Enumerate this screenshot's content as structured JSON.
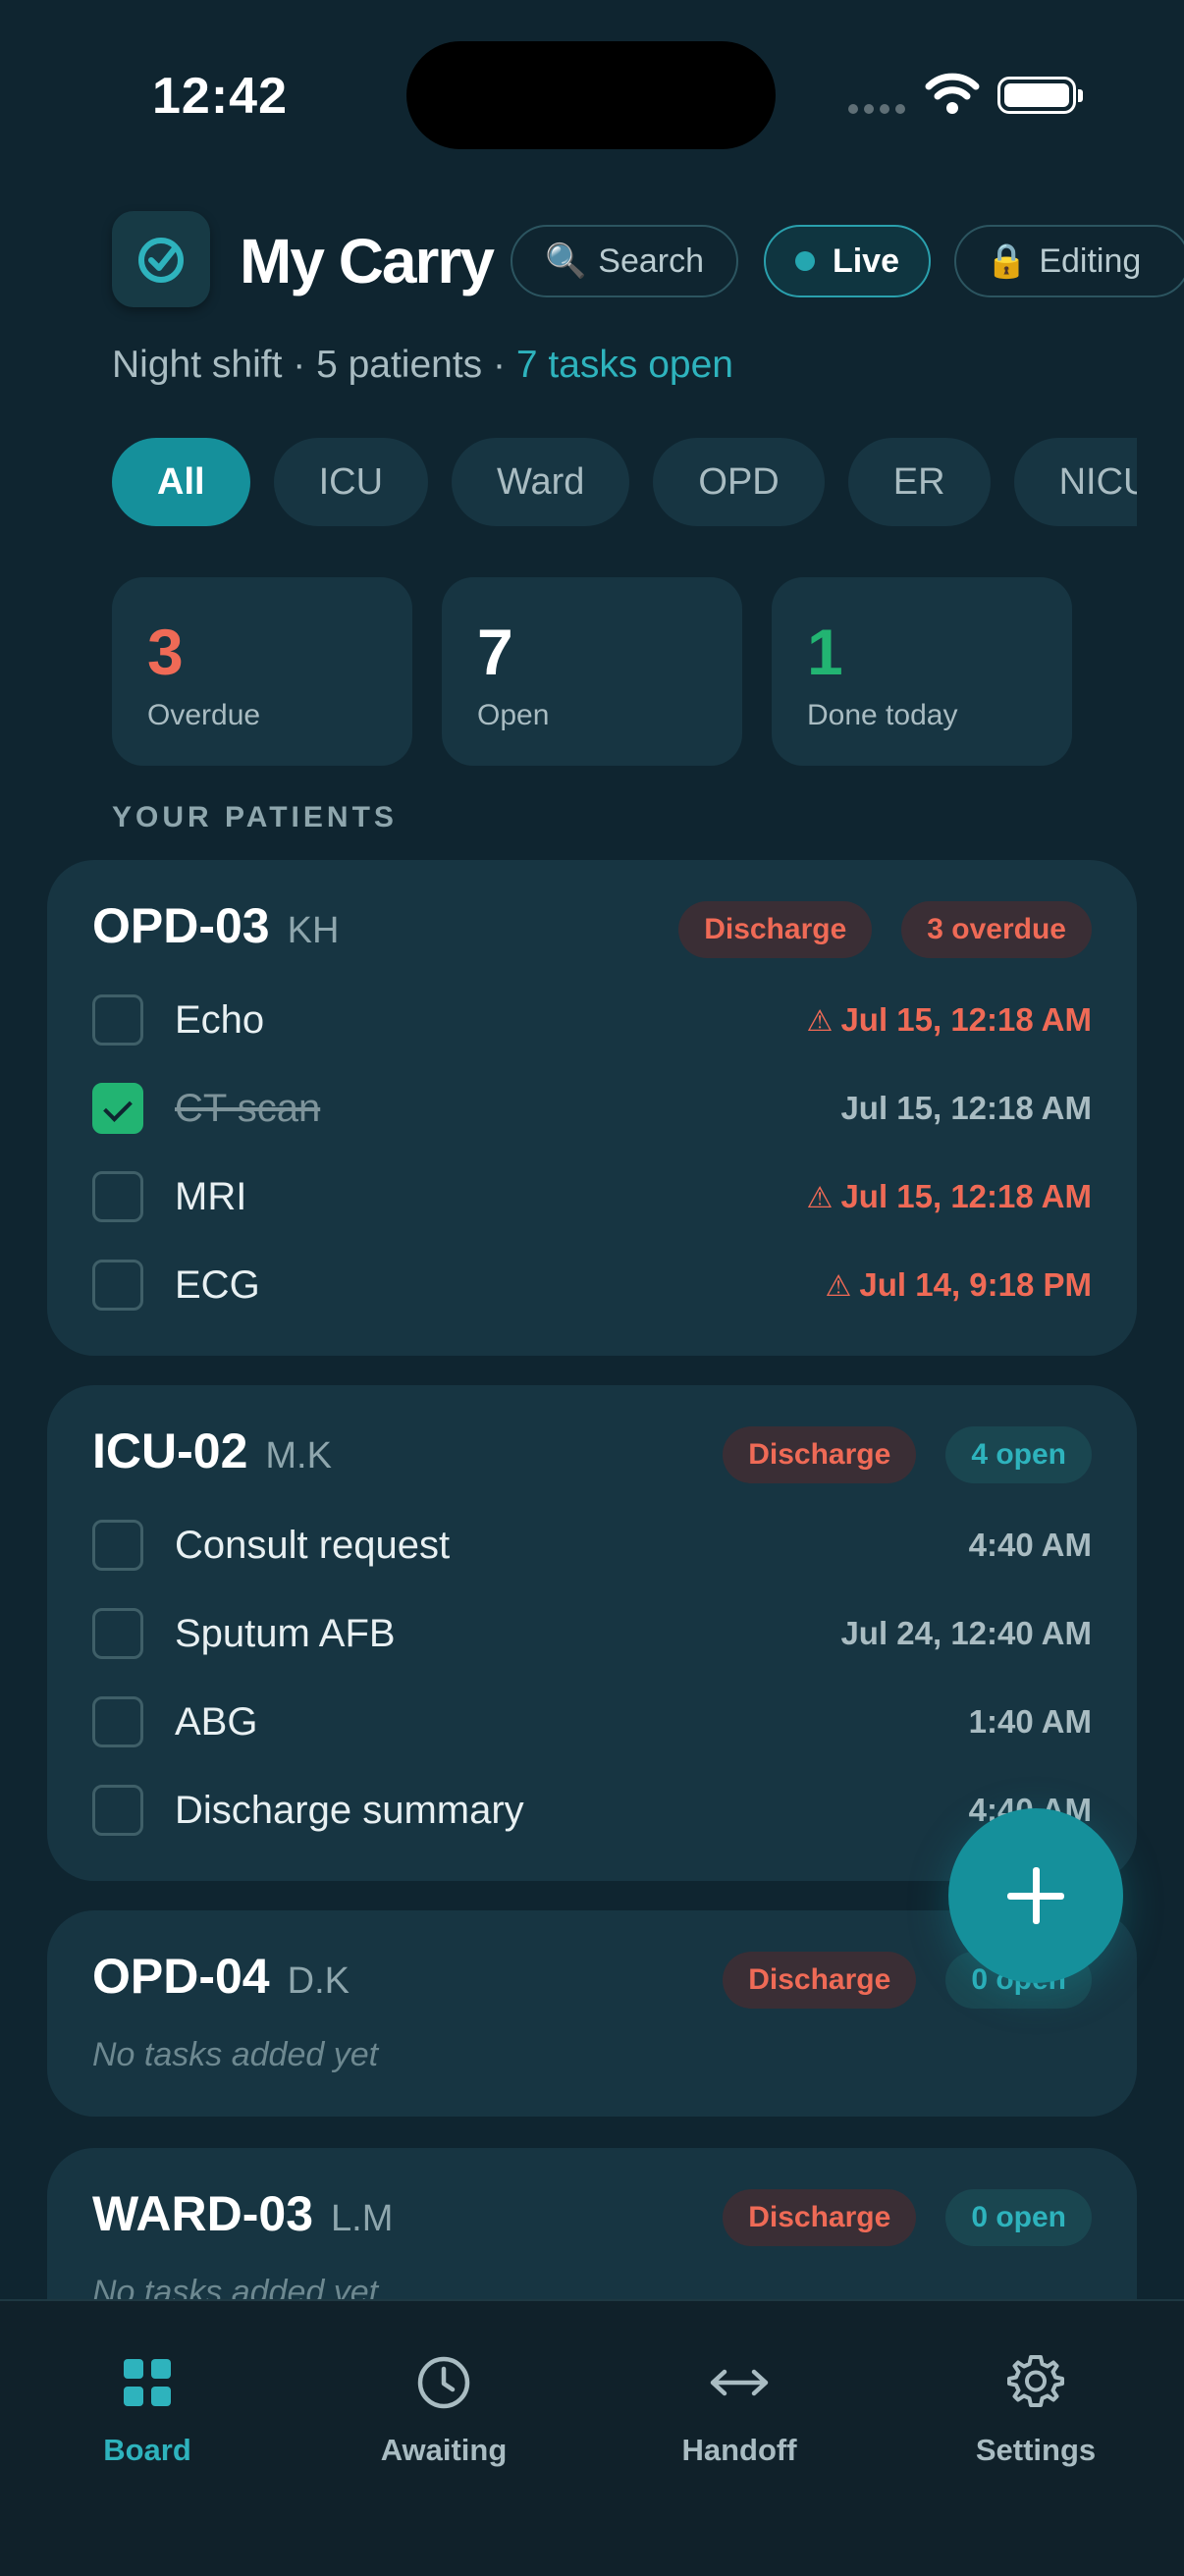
{
  "status_bar": {
    "time": "12:42"
  },
  "header": {
    "title": "My Carry",
    "search_label": "Search",
    "live_label": "Live",
    "editing_label": "Editing"
  },
  "subtitle": {
    "shift": "Night shift · 5 patients · ",
    "tasks_open": "7 tasks open"
  },
  "filters": [
    "All",
    "ICU",
    "Ward",
    "OPD",
    "ER",
    "NICU"
  ],
  "active_filter": "All",
  "stats": [
    {
      "value": "3",
      "label": "Overdue",
      "color": "#ef6a56"
    },
    {
      "value": "7",
      "label": "Open",
      "color": "#ffffff"
    },
    {
      "value": "1",
      "label": "Done today",
      "color": "#22b472"
    }
  ],
  "section_label": "YOUR PATIENTS",
  "patients": [
    {
      "bed": "OPD-03",
      "initials": "KH",
      "badges": [
        "Discharge",
        "3 overdue"
      ],
      "tasks": [
        {
          "name": "Echo",
          "date": "Jul 15, 12:18 AM",
          "overdue": true,
          "done": false
        },
        {
          "name": "CT scan",
          "date": "Jul 15, 12:18 AM",
          "overdue": false,
          "done": true
        },
        {
          "name": "MRI",
          "date": "Jul 15, 12:18 AM",
          "overdue": true,
          "done": false
        },
        {
          "name": "ECG",
          "date": "Jul 14, 9:18 PM",
          "overdue": true,
          "done": false
        }
      ]
    },
    {
      "bed": "ICU-02",
      "initials": "M.K",
      "badges": [
        "Discharge",
        "4 open"
      ],
      "tasks": [
        {
          "name": "Consult request",
          "date": "4:40 AM",
          "overdue": false,
          "done": false
        },
        {
          "name": "Sputum AFB",
          "date": "Jul 24, 12:40 AM",
          "overdue": false,
          "done": false
        },
        {
          "name": "ABG",
          "date": "1:40 AM",
          "overdue": false,
          "done": false
        },
        {
          "name": "Discharge summary",
          "date": "4:40 AM",
          "overdue": false,
          "done": false
        }
      ]
    },
    {
      "bed": "OPD-04",
      "initials": "D.K",
      "badges": [
        "Discharge",
        "0 open"
      ],
      "empty": "No tasks added yet"
    },
    {
      "bed": "WARD-03",
      "initials": "L.M",
      "badges": [
        "Discharge",
        "0 open"
      ],
      "empty": "No tasks added yet"
    }
  ],
  "tabs": [
    {
      "label": "Board",
      "icon": "grid-icon"
    },
    {
      "label": "Awaiting",
      "icon": "clock-icon"
    },
    {
      "label": "Handoff",
      "icon": "swap-arrows-icon"
    },
    {
      "label": "Settings",
      "icon": "gear-icon"
    }
  ],
  "colors": {
    "accent": "#15909b",
    "overdue": "#ef6a56",
    "done": "#22b472",
    "background": "#0f2530",
    "card": "#173542"
  }
}
